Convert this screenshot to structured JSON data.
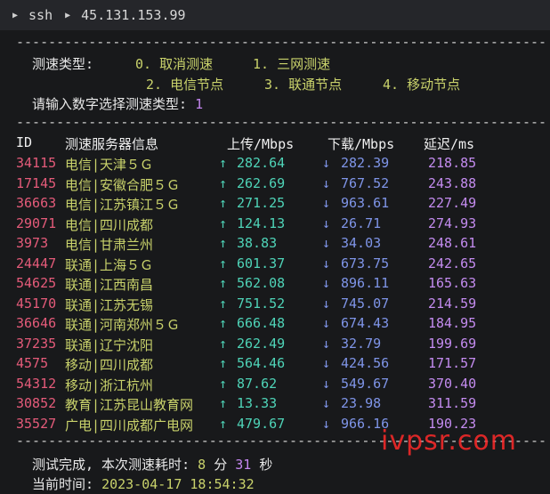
{
  "tabbar": {
    "label": "ssh",
    "host": "45.131.153.99"
  },
  "separator": "------------------------------------------------------------------",
  "menu": {
    "label": "测速类型:",
    "opt0": "0. 取消测速",
    "opt1": "1. 三网测速",
    "opt2": "2. 电信节点",
    "opt3": "3. 联通节点",
    "opt4": "4. 移动节点",
    "prompt": "请输入数字选择测速类型:",
    "choice": "1"
  },
  "table": {
    "headers": {
      "id": "ID",
      "server": "测速服务器信息",
      "up": "上传/Mbps",
      "down": "下载/Mbps",
      "ping": "延迟/ms"
    },
    "up_arrow": "↑",
    "down_arrow": "↓",
    "rows": [
      {
        "id": "34115",
        "server": "电信|天津５Ｇ",
        "up": "282.64",
        "down": "282.39",
        "ping": "218.85"
      },
      {
        "id": "17145",
        "server": "电信|安徽合肥５Ｇ",
        "up": "262.69",
        "down": "767.52",
        "ping": "243.88"
      },
      {
        "id": "36663",
        "server": "电信|江苏镇江５Ｇ",
        "up": "271.25",
        "down": "963.61",
        "ping": "227.49"
      },
      {
        "id": "29071",
        "server": "电信|四川成都",
        "up": "124.13",
        "down": "26.71",
        "ping": "274.93"
      },
      {
        "id": "3973",
        "server": "电信|甘肃兰州",
        "up": "38.83",
        "down": "34.03",
        "ping": "248.61"
      },
      {
        "id": "24447",
        "server": "联通|上海５Ｇ",
        "up": "601.37",
        "down": "673.75",
        "ping": "242.65"
      },
      {
        "id": "54625",
        "server": "联通|江西南昌",
        "up": "562.08",
        "down": "896.11",
        "ping": "165.63"
      },
      {
        "id": "45170",
        "server": "联通|江苏无锡",
        "up": "751.52",
        "down": "745.07",
        "ping": "214.59"
      },
      {
        "id": "36646",
        "server": "联通|河南郑州５Ｇ",
        "up": "666.48",
        "down": "674.43",
        "ping": "184.95"
      },
      {
        "id": "37235",
        "server": "联通|辽宁沈阳",
        "up": "262.49",
        "down": "32.79",
        "ping": "199.69"
      },
      {
        "id": "4575",
        "server": "移动|四川成都",
        "up": "564.46",
        "down": "424.56",
        "ping": "171.57"
      },
      {
        "id": "54312",
        "server": "移动|浙江杭州",
        "up": "87.62",
        "down": "549.67",
        "ping": "370.40"
      },
      {
        "id": "30852",
        "server": "教育|江苏昆山教育网",
        "up": "13.33",
        "down": "23.98",
        "ping": "311.59"
      },
      {
        "id": "35527",
        "server": "广电|四川成都广电网",
        "up": "479.67",
        "down": "966.16",
        "ping": "190.23"
      }
    ]
  },
  "footer": {
    "done_label": "测试完成, 本次测速耗时:",
    "minutes": "8",
    "min_unit": "分",
    "seconds": "31",
    "sec_unit": "秒",
    "time_label": "当前时间:",
    "time_value": "2023-04-17 18:54:32"
  },
  "watermark": "ivpsr.com"
}
